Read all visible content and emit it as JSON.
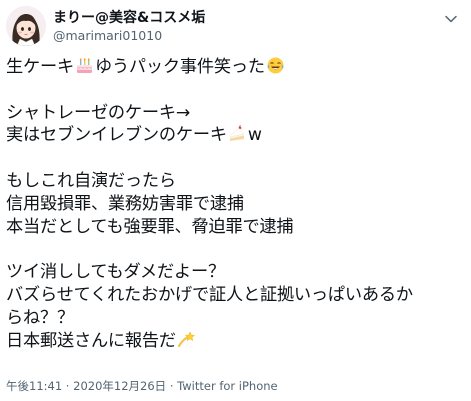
{
  "author": {
    "display_name": "まりー@美容&コスメ垢",
    "handle": "@marimari01010"
  },
  "tweet": {
    "line1": "生ケーキ",
    "line1_tail": "ゆうパック事件笑った",
    "line2": "シャトレーゼのケーキ→",
    "line3": "実はセブンイレブンのケーキ",
    "line3_tail": "w",
    "line4": "もしこれ自演だったら",
    "line5": "信用毀損罪、業務妨害罪で逮捕",
    "line6": "本当だとしても強要罪、脅迫罪で逮捕",
    "line7": "ツイ消ししてもダメだよー？",
    "line8": "バズらせてくれたおかげで証人と証拠いっぱいあるか",
    "line9": "らね？？",
    "line10": "日本郵送さんに報告だ"
  },
  "icons": {
    "more": "chevron-down-icon",
    "emoji1": "birthday-cake-emoji",
    "emoji2": "tears-of-joy-emoji",
    "emoji3": "shortcake-emoji",
    "emoji4": "dizzy-star-emoji"
  },
  "footer": {
    "time": "午後11:41",
    "sep1": " · ",
    "date": "2020年12月26日",
    "sep2": " · ",
    "source": "Twitter for iPhone"
  },
  "colors": {
    "text": "#0f1419",
    "secondary": "#536471"
  }
}
